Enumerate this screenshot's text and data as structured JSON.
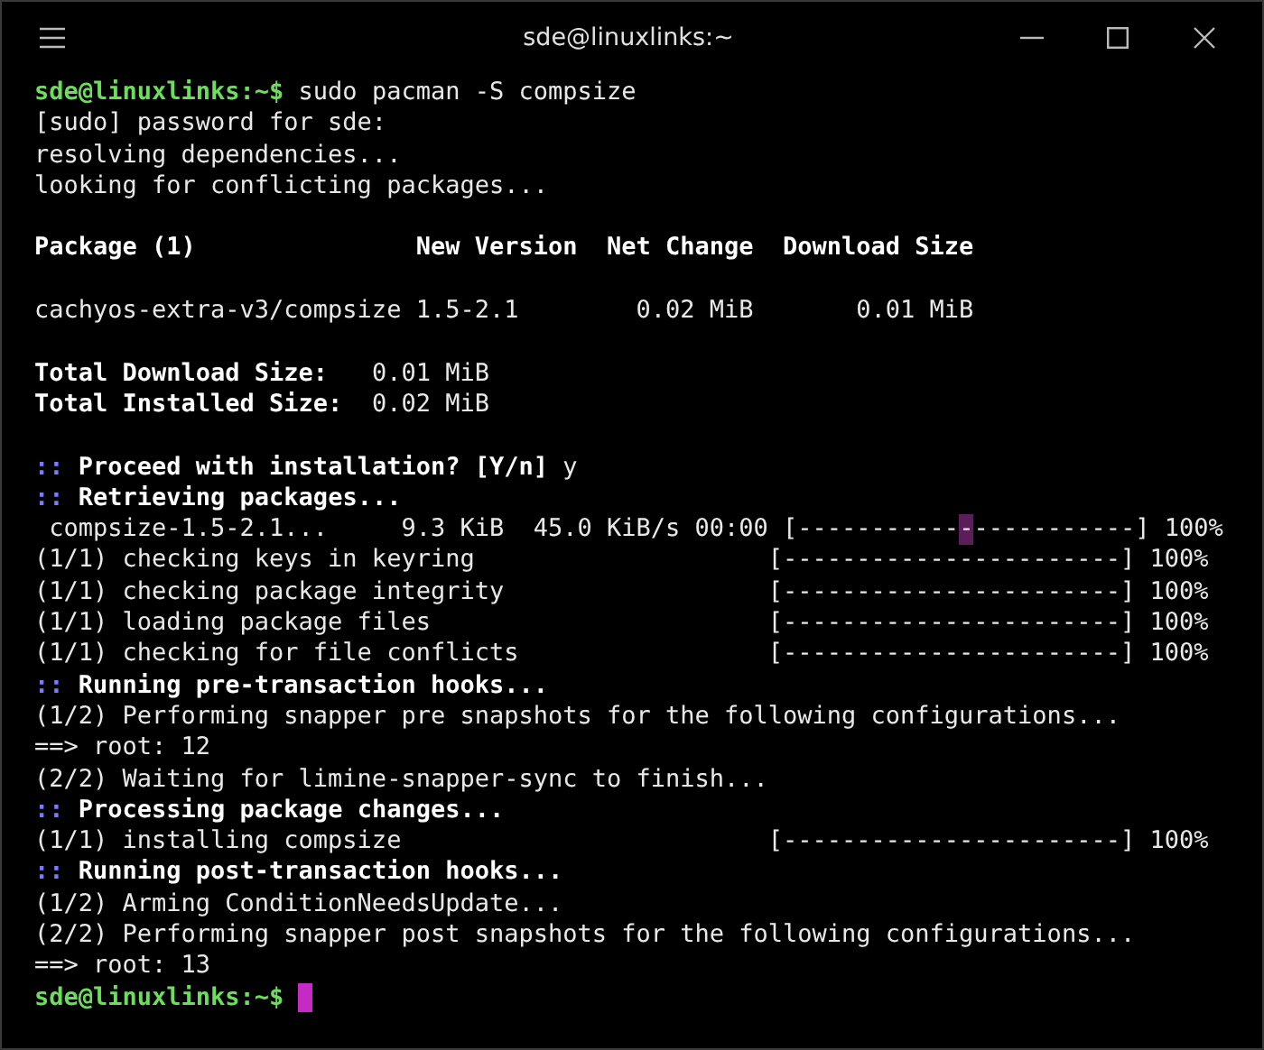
{
  "window": {
    "title": "sde@linuxlinks:~"
  },
  "terminal": {
    "cursor_visible": true,
    "lines": [
      {
        "gap_before": false,
        "segments": [
          {
            "kind": "prompt",
            "text": "sde@linuxlinks:~$"
          },
          {
            "kind": "plain",
            "text": " sudo pacman -S compsize"
          }
        ]
      },
      {
        "gap_before": false,
        "segments": [
          {
            "kind": "plain",
            "text": "[sudo] password for sde:"
          }
        ]
      },
      {
        "gap_before": false,
        "segments": [
          {
            "kind": "plain",
            "text": "resolving dependencies..."
          }
        ]
      },
      {
        "gap_before": false,
        "segments": [
          {
            "kind": "plain",
            "text": "looking for conflicting packages..."
          }
        ]
      },
      {
        "gap_before": true,
        "segments": [
          {
            "kind": "bold",
            "text": "Package (1)               New Version  Net Change  Download Size"
          }
        ]
      },
      {
        "gap_before": true,
        "segments": [
          {
            "kind": "plain",
            "text": "cachyos-extra-v3/compsize 1.5-2.1        0.02 MiB       0.01 MiB"
          }
        ]
      },
      {
        "gap_before": true,
        "segments": [
          {
            "kind": "bold",
            "text": "Total Download Size: "
          },
          {
            "kind": "plain",
            "text": "  0.01 MiB"
          }
        ]
      },
      {
        "gap_before": false,
        "segments": [
          {
            "kind": "bold",
            "text": "Total Installed Size: "
          },
          {
            "kind": "plain",
            "text": " 0.02 MiB"
          }
        ]
      },
      {
        "gap_before": true,
        "segments": [
          {
            "kind": "marker",
            "text": "::"
          },
          {
            "kind": "bold",
            "text": " Proceed with installation? [Y/n]"
          },
          {
            "kind": "plain",
            "text": " y"
          }
        ]
      },
      {
        "gap_before": false,
        "segments": [
          {
            "kind": "marker",
            "text": "::"
          },
          {
            "kind": "bold",
            "text": " Retrieving packages..."
          }
        ]
      },
      {
        "gap_before": false,
        "segments": [
          {
            "kind": "plain",
            "text": " compsize-1.5-2.1...     9.3 KiB  45.0 KiB/s 00:00 "
          },
          {
            "kind": "bar",
            "text": "[-----------"
          },
          {
            "kind": "highlight",
            "text": "-"
          },
          {
            "kind": "bar",
            "text": "-----------]"
          },
          {
            "kind": "plain",
            "text": " 100%"
          }
        ]
      },
      {
        "gap_before": false,
        "segments": [
          {
            "kind": "plain",
            "text": "(1/1) checking keys in keyring                    "
          },
          {
            "kind": "bar",
            "text": "[-----------------------]"
          },
          {
            "kind": "plain",
            "text": " 100%"
          }
        ]
      },
      {
        "gap_before": false,
        "segments": [
          {
            "kind": "plain",
            "text": "(1/1) checking package integrity                  "
          },
          {
            "kind": "bar",
            "text": "[-----------------------]"
          },
          {
            "kind": "plain",
            "text": " 100%"
          }
        ]
      },
      {
        "gap_before": false,
        "segments": [
          {
            "kind": "plain",
            "text": "(1/1) loading package files                       "
          },
          {
            "kind": "bar",
            "text": "[-----------------------]"
          },
          {
            "kind": "plain",
            "text": " 100%"
          }
        ]
      },
      {
        "gap_before": false,
        "segments": [
          {
            "kind": "plain",
            "text": "(1/1) checking for file conflicts                 "
          },
          {
            "kind": "bar",
            "text": "[-----------------------]"
          },
          {
            "kind": "plain",
            "text": " 100%"
          }
        ]
      },
      {
        "gap_before": false,
        "segments": [
          {
            "kind": "marker",
            "text": "::"
          },
          {
            "kind": "bold",
            "text": " Running pre-transaction hooks..."
          }
        ]
      },
      {
        "gap_before": false,
        "segments": [
          {
            "kind": "plain",
            "text": "(1/2) Performing snapper pre snapshots for the following configurations..."
          }
        ]
      },
      {
        "gap_before": false,
        "segments": [
          {
            "kind": "plain",
            "text": "==> root: 12"
          }
        ]
      },
      {
        "gap_before": false,
        "segments": [
          {
            "kind": "plain",
            "text": "(2/2) Waiting for limine-snapper-sync to finish..."
          }
        ]
      },
      {
        "gap_before": false,
        "segments": [
          {
            "kind": "marker",
            "text": "::"
          },
          {
            "kind": "bold",
            "text": " Processing package changes..."
          }
        ]
      },
      {
        "gap_before": false,
        "segments": [
          {
            "kind": "plain",
            "text": "(1/1) installing compsize                         "
          },
          {
            "kind": "bar",
            "text": "[-----------------------]"
          },
          {
            "kind": "plain",
            "text": " 100%"
          }
        ]
      },
      {
        "gap_before": false,
        "segments": [
          {
            "kind": "marker",
            "text": "::"
          },
          {
            "kind": "bold",
            "text": " Running post-transaction hooks..."
          }
        ]
      },
      {
        "gap_before": false,
        "segments": [
          {
            "kind": "plain",
            "text": "(1/2) Arming ConditionNeedsUpdate..."
          }
        ]
      },
      {
        "gap_before": false,
        "segments": [
          {
            "kind": "plain",
            "text": "(2/2) Performing snapper post snapshots for the following configurations..."
          }
        ]
      },
      {
        "gap_before": false,
        "segments": [
          {
            "kind": "plain",
            "text": "==> root: 13"
          }
        ]
      },
      {
        "gap_before": false,
        "segments": [
          {
            "kind": "prompt",
            "text": "sde@linuxlinks:~$"
          }
        ]
      }
    ]
  }
}
